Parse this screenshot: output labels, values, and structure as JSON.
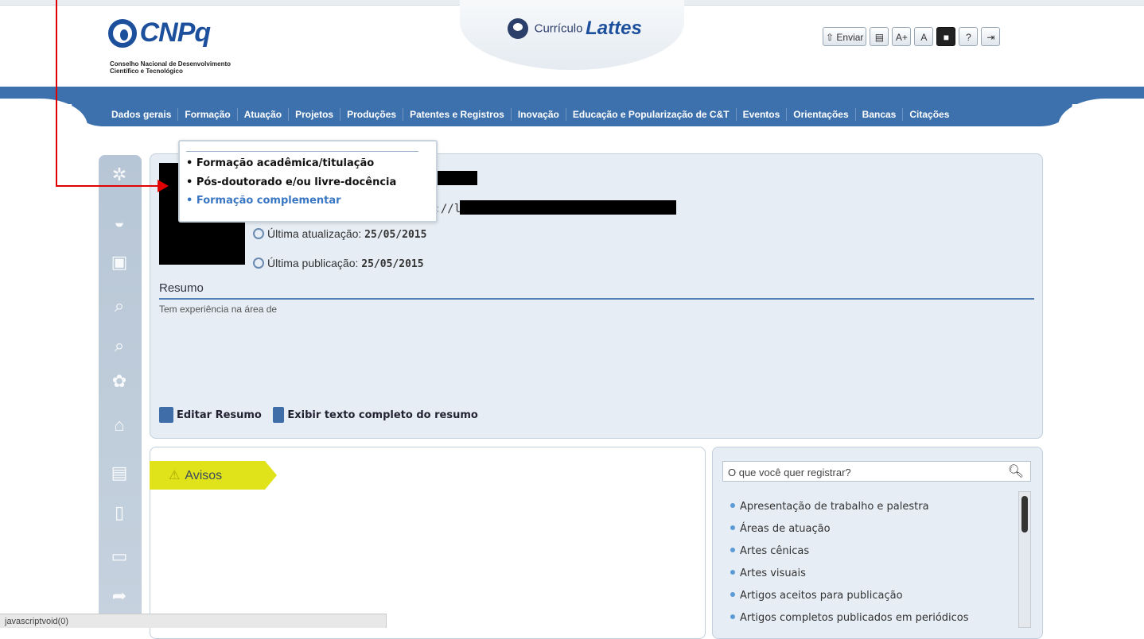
{
  "header": {
    "logo_text": "CNPq",
    "logo_sub1": "Conselho Nacional de Desenvolvimento",
    "logo_sub2": "Científico e Tecnológico",
    "lattes_prefix": "Currículo",
    "lattes_name": "Lattes",
    "toolbar": {
      "enviar": "Enviar",
      "font_increase": "A+",
      "font_normal": "A",
      "help": "?"
    }
  },
  "nav": {
    "items": [
      "Dados gerais",
      "Formação",
      "Atuação",
      "Projetos",
      "Produções",
      "Patentes e Registros",
      "Inovação",
      "Educação e Popularização de C&T",
      "Eventos",
      "Orientações",
      "Bancas",
      "Citações"
    ]
  },
  "dropdown": {
    "items": [
      "Formação acadêmica/titulação",
      "Pós-doutorado e/ou livre-docência",
      "Formação complementar"
    ],
    "highlighted_index": 2
  },
  "profile": {
    "url_prefix": "p://l",
    "last_update_label": "Última atualização:",
    "last_update_value": "25/05/2015",
    "last_publication_label": "Última publicação:",
    "last_publication_value": "25/05/2015",
    "resumo_heading": "Resumo",
    "resumo_text": "Tem experiência na área de",
    "edit_resumo": "Editar Resumo",
    "show_full_resumo": "Exibir texto completo do resumo"
  },
  "avisos": {
    "label": "Avisos"
  },
  "register": {
    "search_placeholder": "O que você quer registrar?",
    "items": [
      "Apresentação de trabalho e palestra",
      "Áreas de atuação",
      "Artes cênicas",
      "Artes visuais",
      "Artigos aceitos para publicação",
      "Artigos completos publicados em periódicos"
    ]
  },
  "statusbar": {
    "text": "javascriptvoid(0)"
  },
  "colors": {
    "nav": "#3d71ad",
    "brand": "#1c4f9c",
    "annotation_arrow": "#e00000",
    "avisos_tab": "#e0e31a"
  }
}
